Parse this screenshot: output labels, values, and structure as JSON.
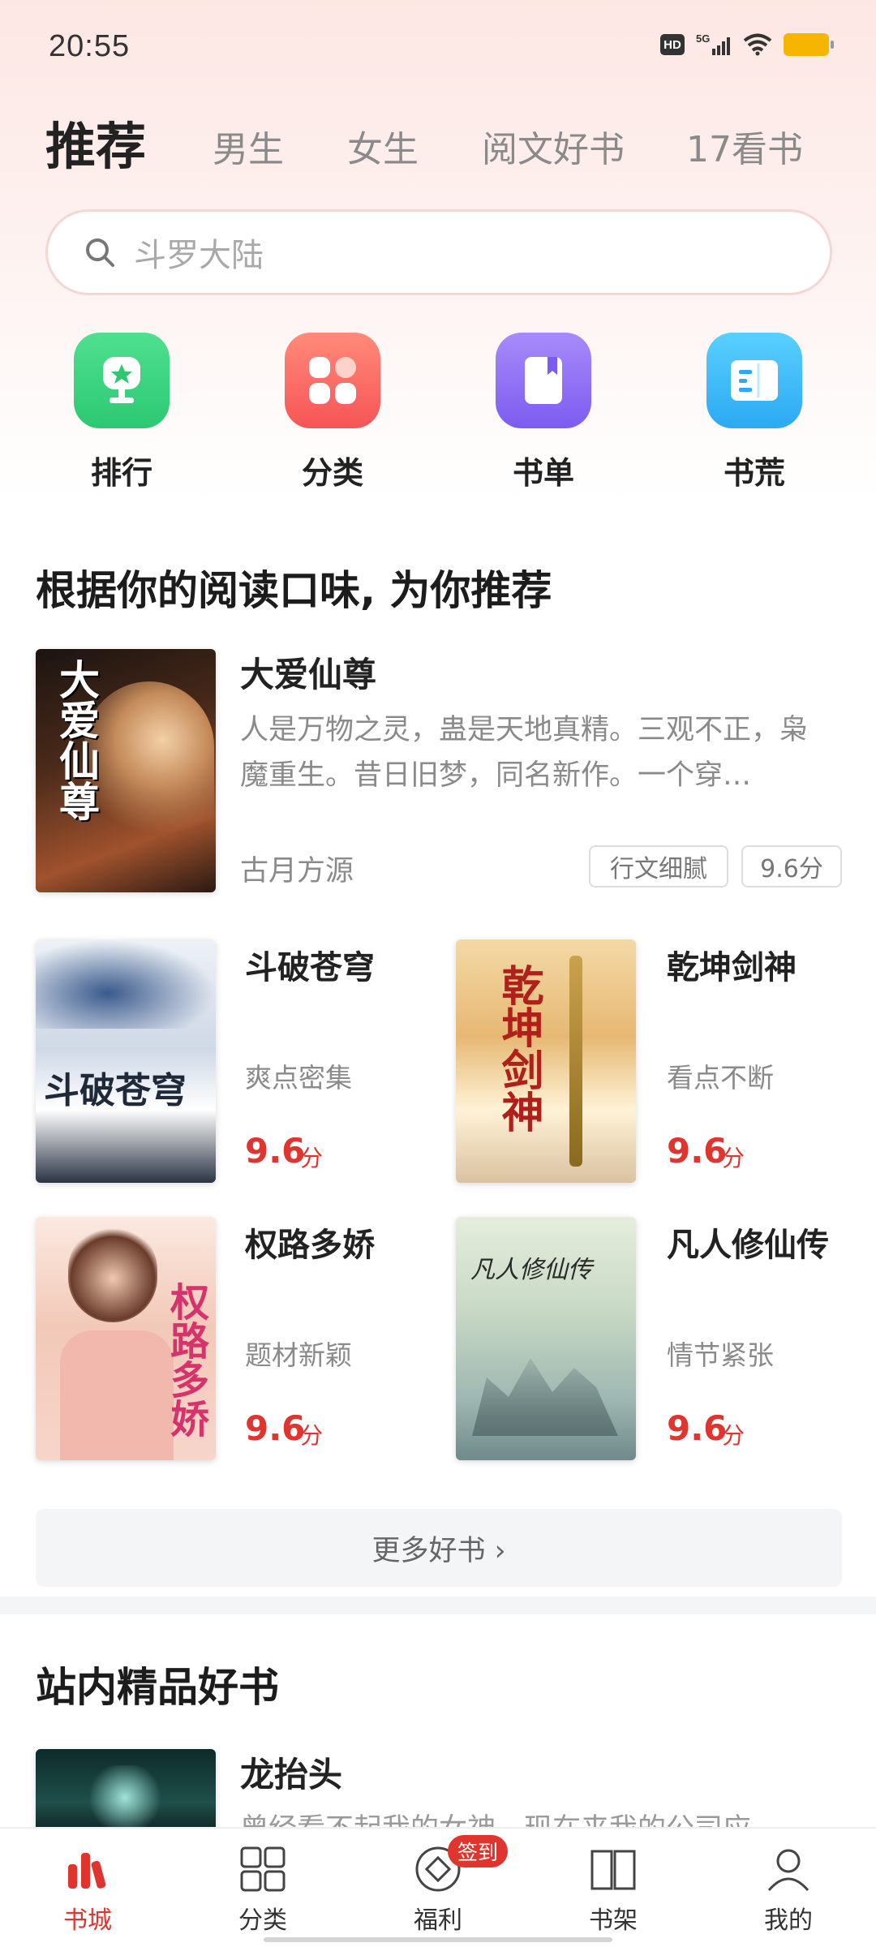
{
  "status": {
    "time": "20:55",
    "hd_label": "HD",
    "network": "5G"
  },
  "tabs": [
    {
      "label": "推荐",
      "active": true
    },
    {
      "label": "男生"
    },
    {
      "label": "女生"
    },
    {
      "label": "阅文好书"
    },
    {
      "label": "17看书"
    }
  ],
  "search": {
    "placeholder": "斗罗大陆",
    "icon": "search-icon"
  },
  "quick_entries": [
    {
      "label": "排行",
      "icon": "trophy-icon",
      "color": "#2fd07a"
    },
    {
      "label": "分类",
      "icon": "grid-icon",
      "color": "#ff6b6b"
    },
    {
      "label": "书单",
      "icon": "booklist-icon",
      "color": "#8b6cf6"
    },
    {
      "label": "书荒",
      "icon": "book-open-icon",
      "color": "#2fb8f5"
    }
  ],
  "recommend": {
    "title": "根据你的阅读口味, 为你推荐",
    "featured": {
      "title": "大爱仙尊",
      "description": "人是万物之灵，蛊是天地真精。三观不正，枭魔重生。昔日旧梦，同名新作。一个穿…",
      "author": "古月方源",
      "tags": [
        "行文细腻",
        "9.6分"
      ],
      "cover_text": "大爱仙尊"
    },
    "books": [
      {
        "title": "斗破苍穹",
        "tag": "爽点密集",
        "score": "9.6",
        "unit": "分",
        "cover_text": "斗破苍穹"
      },
      {
        "title": "乾坤剑神",
        "tag": "看点不断",
        "score": "9.6",
        "unit": "分",
        "cover_text": "乾坤剑神"
      },
      {
        "title": "权路多娇",
        "tag": "题材新颖",
        "score": "9.6",
        "unit": "分",
        "cover_text": "权路多娇"
      },
      {
        "title": "凡人修仙传",
        "tag": "情节紧张",
        "score": "9.6",
        "unit": "分",
        "cover_text": "凡人修仙传"
      }
    ],
    "more_label": "更多好书 ›"
  },
  "premium": {
    "title": "站内精品好书",
    "book": {
      "title": "龙抬头",
      "description": "曾经看不起我的女神，现在来我的公司应…"
    }
  },
  "bottom_nav": [
    {
      "label": "书城",
      "icon": "bookstore-icon",
      "active": true
    },
    {
      "label": "分类",
      "icon": "category-icon"
    },
    {
      "label": "福利",
      "icon": "welfare-icon",
      "badge": "签到"
    },
    {
      "label": "书架",
      "icon": "bookshelf-icon"
    },
    {
      "label": "我的",
      "icon": "profile-icon"
    }
  ],
  "colors": {
    "accent": "#e0342f",
    "muted": "#8a8a8a"
  }
}
